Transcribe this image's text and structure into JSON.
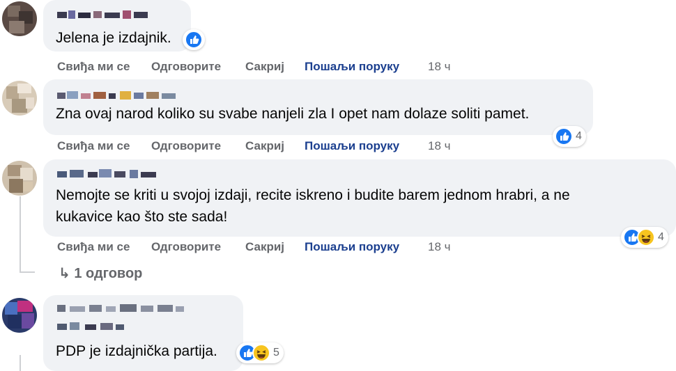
{
  "comments": [
    {
      "text_lines": [
        "Jelena je izdajnik."
      ],
      "actions": {
        "like": "Свиђа ми се",
        "reply": "Одговорите",
        "hide": "Сакриј",
        "send": "Пошаљи поруку",
        "time": "18 ч"
      },
      "reactions": {
        "icons": [
          "like-icon"
        ],
        "count": ""
      }
    },
    {
      "text_lines": [
        "Zna ovaj narod koliko su svabe nanjeli zla I opet nam dolaze soliti pamet."
      ],
      "actions": {
        "like": "Свиђа ми се",
        "reply": "Одговорите",
        "hide": "Сакриј",
        "send": "Пошаљи поруку",
        "time": "18 ч"
      },
      "reactions": {
        "icons": [
          "like-icon"
        ],
        "count": "4"
      }
    },
    {
      "text_lines": [
        "Nemojte se kriti u svojoj izdaji, recite iskreno i budite barem jednom hrabri, a ne",
        "kukavice kao što ste sada!"
      ],
      "actions": {
        "like": "Свиђа ми се",
        "reply": "Одговорите",
        "hide": "Сакриј",
        "send": "Пошаљи поруку",
        "time": "18 ч"
      },
      "reactions": {
        "icons": [
          "like-icon",
          "haha-icon"
        ],
        "count": "4"
      },
      "replies_label": "↳ 1 одговор"
    },
    {
      "text_lines": [
        "PDP je izdajnička partija."
      ],
      "reactions": {
        "icons": [
          "like-icon",
          "haha-icon"
        ],
        "count": "5"
      }
    }
  ],
  "colors": {
    "bubble": "#f0f2f5",
    "action_text": "#65676b",
    "send_link": "#1b3f8f",
    "like_blue": "#1877f2",
    "haha_yellow": "#f7c41f"
  }
}
